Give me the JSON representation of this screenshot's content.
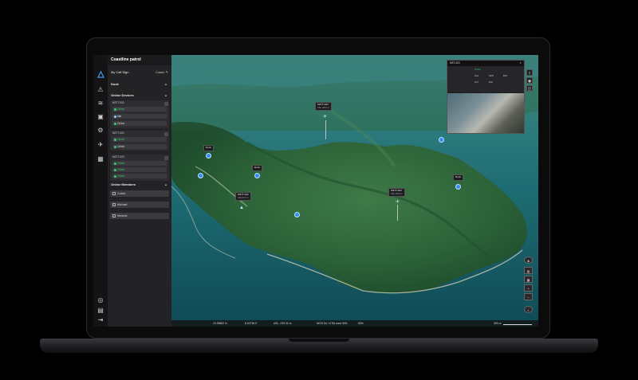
{
  "panel": {
    "title": "Coastline patrol",
    "call_sign_label": "My Call Sign",
    "call_sign_value": "Coach",
    "dock_label": "Dock",
    "online_devices_label": "Online Devices",
    "online_members_label": "Online Members"
  },
  "devices": [
    {
      "name": "M3TT-003",
      "rows": [
        {
          "label": "Online",
          "color": "#37c26b"
        },
        {
          "label": "Idle",
          "color": "#7fc4ff"
        },
        {
          "label": "Online",
          "color": "#37c26b"
        }
      ]
    },
    {
      "name": "M3TT-002",
      "rows": [
        {
          "label": "Online",
          "color": "#37c26b"
        },
        {
          "label": "Online",
          "color": "#37c26b"
        }
      ]
    },
    {
      "name": "M3TT-003",
      "rows": [
        {
          "label": "Online",
          "color": "#37c26b"
        },
        {
          "label": "Online",
          "color": "#37c26b"
        },
        {
          "label": "Online",
          "color": "#37c26b"
        }
      ]
    }
  ],
  "members": [
    "Coach",
    "Michael",
    "Melanie"
  ],
  "map_tags": [
    {
      "title": "M3TT-303",
      "sub": "ASL 100.0 m"
    },
    {
      "title": "Dock",
      "sub": ""
    },
    {
      "title": "M3TT-302",
      "sub": "ASL 103.0 m"
    },
    {
      "title": "M3TT-302",
      "sub": "ASL 83.6 m"
    },
    {
      "title": "Dock",
      "sub": ""
    },
    {
      "title": "M3TT-303",
      "sub": "ASL 103.0 m"
    },
    {
      "title": "Dock",
      "sub": ""
    }
  ],
  "popup": {
    "title": "M3T-303",
    "stats": [
      "Online",
      "ASL",
      "SPD",
      "BAT",
      "ALT",
      "DIS"
    ],
    "button": "FPV"
  },
  "statusbar": {
    "lat": "19.99802 N",
    "lon": "8.92735 E",
    "asl": "ASL: 239.31 m",
    "datum": "WGS 84 / UTM zone 50N",
    "percent": "60%",
    "scale": "300 m"
  },
  "colors": {
    "accent": "#2f8ff0",
    "online": "#37c26b"
  }
}
